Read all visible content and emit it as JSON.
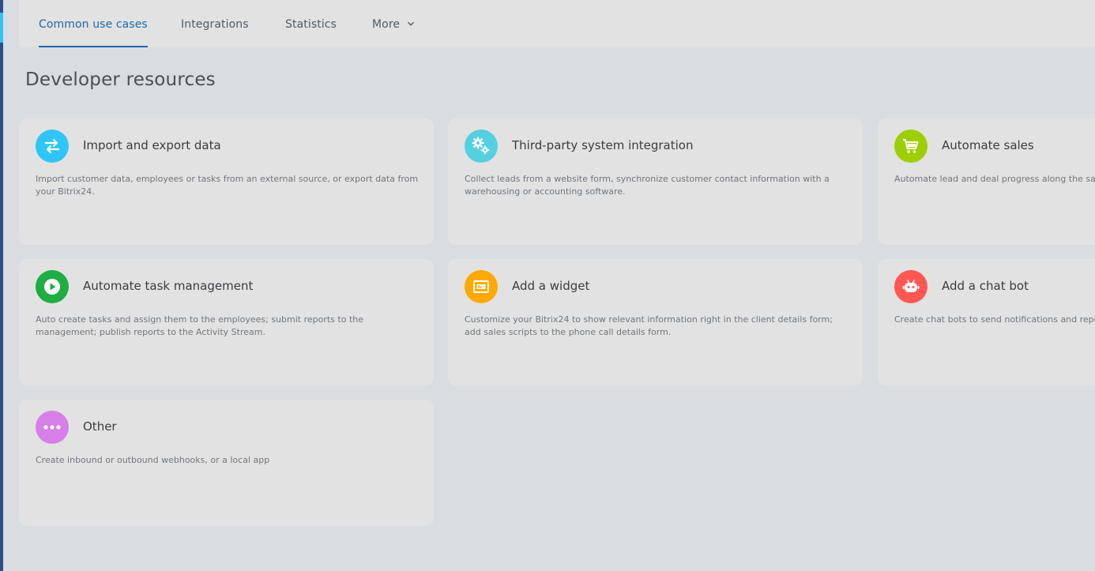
{
  "nav": {
    "tabs": [
      {
        "label": "Common use cases",
        "active": true
      },
      {
        "label": "Integrations",
        "active": false
      },
      {
        "label": "Statistics",
        "active": false
      },
      {
        "label": "More",
        "active": false
      }
    ]
  },
  "page": {
    "title": "Developer resources"
  },
  "cards": [
    {
      "title": "Import and export data",
      "description": "Import customer data, employees or tasks from an external source, or export data from your Bitrix24.",
      "icon": "swap-arrows-icon",
      "color": "#2fc6f6"
    },
    {
      "title": "Third-party system integration",
      "description": "Collect leads from a website form, synchronize customer contact information with a warehousing or accounting software.",
      "icon": "gears-icon",
      "color": "#55d0e0"
    },
    {
      "title": "Automate sales",
      "description": "Automate lead and deal progress along the sales funnel",
      "icon": "shopping-cart-icon",
      "color": "#9dcf00"
    },
    {
      "title": "Automate task management",
      "description": "Auto create tasks and assign them to the employees; submit reports to the management; publish reports to the Activity Stream.",
      "icon": "play-icon",
      "color": "#1eae43"
    },
    {
      "title": "Add a widget",
      "description": "Customize your Bitrix24 to show relevant information right in the client details form; add sales scripts to the phone call details form.",
      "icon": "widget-icon",
      "color": "#ffa900"
    },
    {
      "title": "Add a chat bot",
      "description": "Create chat bots to send notifications and reports",
      "icon": "robot-icon",
      "color": "#ff5752"
    },
    {
      "title": "Other",
      "description": "Create inbound or outbound webhooks, or a local app",
      "icon": "more-dots-icon",
      "color": "#d77ee8"
    }
  ]
}
